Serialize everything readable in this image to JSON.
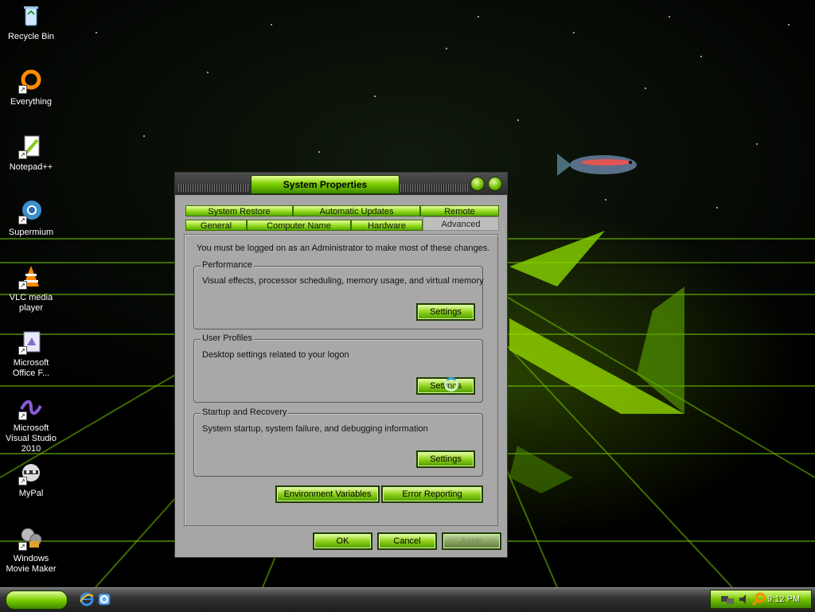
{
  "desktop": {
    "icons": [
      {
        "label": "Recycle Bin",
        "icon": "recycle-bin-icon"
      },
      {
        "label": "Everything",
        "icon": "everything-search-icon"
      },
      {
        "label": "Notepad++",
        "icon": "notepad-plus-plus-icon"
      },
      {
        "label": "Supermium",
        "icon": "supermium-browser-icon"
      },
      {
        "label": "VLC media player",
        "icon": "vlc-cone-icon"
      },
      {
        "label": "Microsoft Office F...",
        "icon": "office-file-icon"
      },
      {
        "label": "Microsoft Visual Studio 2010",
        "icon": "visual-studio-icon"
      },
      {
        "label": "MyPal",
        "icon": "mypal-raccoon-icon"
      },
      {
        "label": "Windows Movie Maker",
        "icon": "movie-maker-icon"
      }
    ]
  },
  "window": {
    "title": "System Properties",
    "tabs_row1": [
      "System Restore",
      "Automatic Updates",
      "Remote"
    ],
    "tabs_row2": [
      "General",
      "Computer Name",
      "Hardware",
      "Advanced"
    ],
    "active_tab": "Advanced",
    "admin_note": "You must be logged on as an Administrator to make most of these changes.",
    "performance": {
      "title": "Performance",
      "description": "Visual effects, processor scheduling, memory usage, and virtual memory",
      "button": "Settings"
    },
    "user_profiles": {
      "title": "User Profiles",
      "description": "Desktop settings related to your logon",
      "button": "Settings"
    },
    "startup_recovery": {
      "title": "Startup and Recovery",
      "description": "System startup, system failure, and debugging information",
      "button": "Settings"
    },
    "env_vars_button": "Environment Variables",
    "error_reporting_button": "Error Reporting",
    "ok_button": "OK",
    "cancel_button": "Cancel",
    "apply_button": "Apply"
  },
  "taskbar": {
    "clock": "9:12 PM",
    "quick_launch": [
      "internet-explorer-icon",
      "outlook-express-icon"
    ]
  },
  "colors": {
    "accent_green": "#7fd000",
    "dark_green": "#1f3b00",
    "window_gray": "#a6a6a6"
  }
}
